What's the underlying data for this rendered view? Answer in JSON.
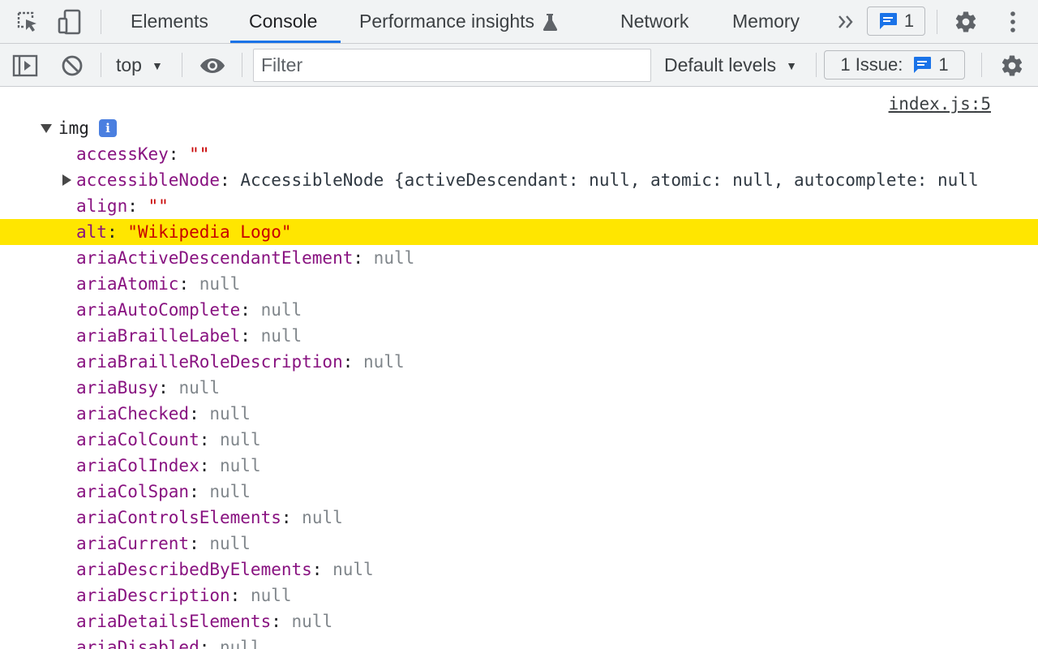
{
  "tabs": [
    {
      "label": "Elements",
      "active": false
    },
    {
      "label": "Console",
      "active": true
    },
    {
      "label": "Performance insights",
      "active": false
    },
    {
      "label": "Network",
      "active": false
    },
    {
      "label": "Memory",
      "active": false
    }
  ],
  "tabbar": {
    "messages_count": "1"
  },
  "toolbar": {
    "context": "top",
    "filter_placeholder": "Filter",
    "filter_value": "",
    "levels_label": "Default levels",
    "issues_label": "1 Issue:",
    "issues_count": "1"
  },
  "console": {
    "source_link": "index.js:5",
    "object_name": "img",
    "properties": [
      {
        "key": "accessKey",
        "value": "\"\"",
        "type": "string",
        "expandable": false,
        "highlight": false
      },
      {
        "key": "accessibleNode",
        "value": "AccessibleNode {activeDescendant: null, atomic: null, autocomplete: null",
        "type": "object",
        "expandable": true,
        "highlight": false
      },
      {
        "key": "align",
        "value": "\"\"",
        "type": "string",
        "expandable": false,
        "highlight": false
      },
      {
        "key": "alt",
        "value": "\"Wikipedia Logo\"",
        "type": "string",
        "expandable": false,
        "highlight": true
      },
      {
        "key": "ariaActiveDescendantElement",
        "value": "null",
        "type": "null",
        "expandable": false,
        "highlight": false
      },
      {
        "key": "ariaAtomic",
        "value": "null",
        "type": "null",
        "expandable": false,
        "highlight": false
      },
      {
        "key": "ariaAutoComplete",
        "value": "null",
        "type": "null",
        "expandable": false,
        "highlight": false
      },
      {
        "key": "ariaBrailleLabel",
        "value": "null",
        "type": "null",
        "expandable": false,
        "highlight": false
      },
      {
        "key": "ariaBrailleRoleDescription",
        "value": "null",
        "type": "null",
        "expandable": false,
        "highlight": false
      },
      {
        "key": "ariaBusy",
        "value": "null",
        "type": "null",
        "expandable": false,
        "highlight": false
      },
      {
        "key": "ariaChecked",
        "value": "null",
        "type": "null",
        "expandable": false,
        "highlight": false
      },
      {
        "key": "ariaColCount",
        "value": "null",
        "type": "null",
        "expandable": false,
        "highlight": false
      },
      {
        "key": "ariaColIndex",
        "value": "null",
        "type": "null",
        "expandable": false,
        "highlight": false
      },
      {
        "key": "ariaColSpan",
        "value": "null",
        "type": "null",
        "expandable": false,
        "highlight": false
      },
      {
        "key": "ariaControlsElements",
        "value": "null",
        "type": "null",
        "expandable": false,
        "highlight": false
      },
      {
        "key": "ariaCurrent",
        "value": "null",
        "type": "null",
        "expandable": false,
        "highlight": false
      },
      {
        "key": "ariaDescribedByElements",
        "value": "null",
        "type": "null",
        "expandable": false,
        "highlight": false
      },
      {
        "key": "ariaDescription",
        "value": "null",
        "type": "null",
        "expandable": false,
        "highlight": false
      },
      {
        "key": "ariaDetailsElements",
        "value": "null",
        "type": "null",
        "expandable": false,
        "highlight": false
      },
      {
        "key": "ariaDisabled",
        "value": "null",
        "type": "null",
        "expandable": false,
        "highlight": false
      }
    ]
  },
  "colors": {
    "accent": "#1a73e8",
    "highlight": "#ffe600",
    "property_key": "#881280",
    "string_value": "#c80000",
    "null_value": "#80868b"
  },
  "icons": {
    "inspect": "inspect-element-icon",
    "device": "device-toolbar-icon",
    "flask": "experiment-flask-icon",
    "more_tabs": "chevron-double-right-icon",
    "message": "message-icon",
    "settings": "gear-icon",
    "kebab": "more-vertical-icon",
    "sidebar": "sidebar-toggle-icon",
    "clear": "clear-console-icon",
    "eye": "eye-icon"
  }
}
